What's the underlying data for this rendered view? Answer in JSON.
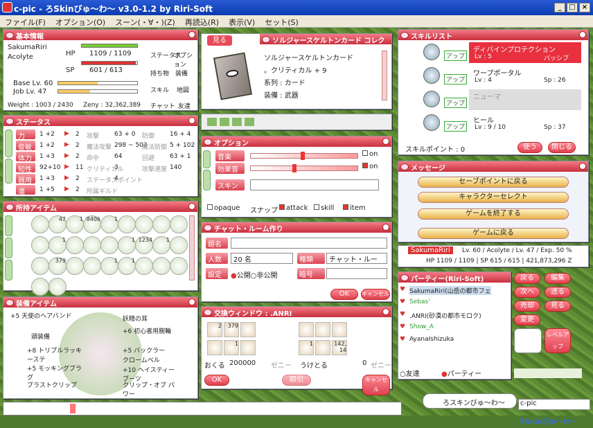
{
  "window": {
    "title": "c-pic - ろSkinびゅ～わ～ v3.0-1.2 by Riri-Soft",
    "min": "_",
    "max": "□",
    "close": "×"
  },
  "menu": [
    "ファイル(F)",
    "オプション(O)",
    "スーン(・∀・)(Z)",
    "再読込(R)",
    "表示(V)",
    "セット(S)"
  ],
  "basic": {
    "title": "基本情報",
    "name": "SakumaRiri",
    "job": "Acolyte",
    "hp_label": "HP",
    "hp": "1109 / 1109",
    "sp_label": "SP",
    "sp": "601 / 613",
    "base_lv": "Base Lv. 60",
    "job_lv": "Job Lv. 47",
    "weight": "Weight : 1003 / 2430",
    "zeny": "Zeny : 32,362,389",
    "hp_frac": 1.0,
    "sp_frac": 0.98,
    "buttons": [
      "ステータス",
      "オプション",
      "持ち物",
      "装備",
      "スキル",
      "地図",
      "チャット",
      "友達"
    ]
  },
  "card": {
    "title": "ソルジャースケルトンカード コレクション",
    "look": "見る",
    "name": "ソルジャースケルトンカード",
    "l1": "。クリティカル + 9",
    "l2": "系列 : カード",
    "l3": "装備 : 武器"
  },
  "status": {
    "title": "ステータス",
    "tabs": [
      "ステータス",
      "スキル"
    ],
    "stats": [
      {
        "n": "力",
        "v": "1 +2",
        "p": "2",
        "k": "攻撃",
        "kv": "63 + 0",
        "k2": "防御",
        "k2v": "16 + 4"
      },
      {
        "n": "俊敏",
        "v": "1 +2",
        "p": "2",
        "k": "魔法攻撃",
        "kv": "298 ~ 502",
        "k2": "魔法防御",
        "k2v": "5 + 102"
      },
      {
        "n": "体力",
        "v": "1 +3",
        "p": "2",
        "k": "命中",
        "kv": "64",
        "k2": "回避",
        "k2v": "63 + 1"
      },
      {
        "n": "知性",
        "v": "92+10",
        "p": "11",
        "k": "クリティカル",
        "kv": "3",
        "k2": "攻撃速度",
        "k2v": "140"
      },
      {
        "n": "器用",
        "v": "1 +3",
        "p": "2",
        "k": "ステータスポイント",
        "kv": "4",
        "k2": "",
        "k2v": ""
      },
      {
        "n": "運",
        "v": "1 +5",
        "p": "2",
        "k": "所属ギルド",
        "kv": "",
        "k2": "",
        "k2v": ""
      }
    ]
  },
  "options": {
    "title": "オプション",
    "tabs": [
      "オプション",
      "ショートカット"
    ],
    "music": "音楽",
    "sfx": "効果音",
    "on1": "on",
    "on2": "on",
    "skin": "スキン",
    "opaque": "opaque",
    "snap": "スナップ",
    "attack": "attack",
    "skill": "skill",
    "item": "item",
    "music_level": 0.48,
    "sfx_level": 0.4
  },
  "skill": {
    "title": "スキルリスト",
    "up": "アップ",
    "items": [
      {
        "name": "ディバインプロテクション",
        "lv": "Lv : 5",
        "type": "パッシブ"
      },
      {
        "name": "ワープポータル",
        "lv": "Lv : 4",
        "type": "Sp : 26"
      },
      {
        "name": "ニューマ",
        "lv": "",
        "type": ""
      },
      {
        "name": "ヒール",
        "lv": "Lv : 9 / 10",
        "type": "Sp : 37"
      }
    ],
    "points": "スキルポイント : 0",
    "use": "使う",
    "close": "閉じる"
  },
  "message": {
    "title": "メッセージ",
    "items": [
      "セーブポイントに戻る",
      "キャラクターセレクト",
      "ゲームを終了する",
      "ゲームに戻る"
    ]
  },
  "items": {
    "title": "所持アイテム",
    "tabs": [
      "アイテム",
      "装備",
      "収集品"
    ],
    "counts": [
      "",
      "47",
      "1",
      "8406",
      "1",
      "",
      "",
      "",
      "",
      "",
      "1",
      "",
      "",
      "",
      "1",
      "1234",
      "1",
      "",
      "",
      "379",
      "",
      "",
      "1",
      "1",
      "",
      "",
      "",
      "",
      ""
    ]
  },
  "chat": {
    "title": "チャット・ルーム作り",
    "name": "題名",
    "num": "人数",
    "num_val": "20 名",
    "type": "種類",
    "type_val": "チャット・ルー",
    "set": "設定",
    "public": "公開",
    "private": "非公開",
    "pw": "暗号",
    "ok": "OK",
    "cancel": "キャンセル"
  },
  "char": {
    "title": "SakumaRiri",
    "info": "Lv. 60 / Acolyte / Lv. 47 / Exp. 50 %",
    "stats": "HP 1109 / 1109 | SP 615 / 615 | 421,873,296 Z"
  },
  "party": {
    "title": "パーティー(Riri-Soft)",
    "members": [
      "SakumaRiri(山岳の都市フェ",
      "Sebas'",
      ".ANRI(砂漠の都市モロク)",
      "Show_A",
      "AyanaIshizuka"
    ],
    "friend": "友達",
    "party": "パーティー",
    "buttons": [
      "戻る",
      "編集",
      "次へ",
      "送る",
      "売却",
      "見る",
      "変更"
    ],
    "levelup": "レベルアップ"
  },
  "equip": {
    "title": "装備アイテム",
    "left": [
      "+5 天使のヘアバンド",
      "頭装備",
      "+8 トリプルラッキーステ",
      "+5 モッキングブラグ",
      "ブラストクリップ"
    ],
    "right": [
      "妖精の耳",
      "+6 初心者用腕輪",
      "+5 バックラー",
      "クロームベル",
      "+10 ヘイスティーブーツ",
      "クリップ・オブ パワー"
    ]
  },
  "trade": {
    "title": "交換ウィンドウ : .ANRI",
    "send": "おくる",
    "zeny": "200000",
    "zeny_unit": "ゼニー",
    "recv": "うけとる",
    "recv_zeny": "0",
    "ok": "OK",
    "cancel": "キャンセル",
    "trade": "取引",
    "counts": [
      "2",
      "379",
      "",
      "",
      "",
      "",
      "",
      "1",
      "",
      "1",
      "",
      "142, 14"
    ]
  },
  "bottom": {
    "chat": "ろスキンびゅ～わ～",
    "cpic": "c-pic",
    "brand": "ろSkinびゅ～わ～"
  }
}
